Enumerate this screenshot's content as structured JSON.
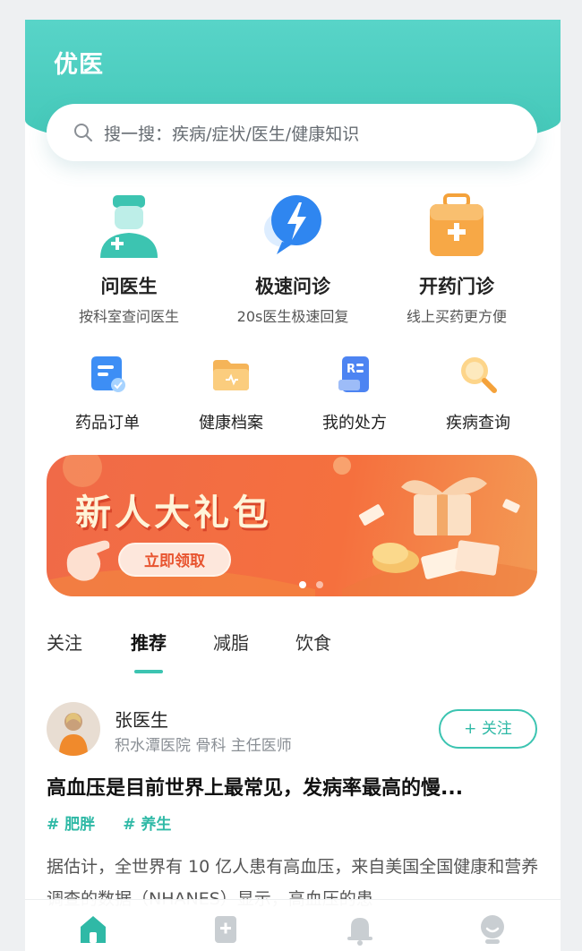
{
  "header": {
    "title": "优医"
  },
  "search": {
    "placeholder": "搜一搜：疾病/症状/医生/健康知识"
  },
  "services": [
    {
      "title": "问医生",
      "subtitle": "按科室查问医生",
      "icon": "doctor-icon"
    },
    {
      "title": "极速问诊",
      "subtitle": "20s医生极速回复",
      "icon": "lightning-chat-icon"
    },
    {
      "title": "开药门诊",
      "subtitle": "线上买药更方便",
      "icon": "medical-kit-icon"
    }
  ],
  "tools": [
    {
      "label": "药品订单",
      "icon": "order-icon"
    },
    {
      "label": "健康档案",
      "icon": "folder-icon"
    },
    {
      "label": "我的处方",
      "icon": "prescription-icon"
    },
    {
      "label": "疾病查询",
      "icon": "magnifier-icon"
    }
  ],
  "banner": {
    "title": "新人大礼包",
    "button": "立即领取",
    "slide_count": 2,
    "active_slide": 1,
    "colors": {
      "main": "#f06a48",
      "button_text": "#e8542f"
    }
  },
  "feed_tabs": [
    {
      "label": "关注",
      "active": false
    },
    {
      "label": "推荐",
      "active": true
    },
    {
      "label": "减脂",
      "active": false
    },
    {
      "label": "饮食",
      "active": false
    }
  ],
  "post": {
    "doctor_name": "张医生",
    "doctor_info": "积水潭医院 骨科 主任医师",
    "follow_label": "+ 关注",
    "title": "高血压是目前世界上最常见，发病率最高的慢...",
    "tags": [
      "# 肥胖",
      "# 养生"
    ],
    "body": "据估计，全世界有 10 亿人患有高血压，来自美国全国健康和营养调查的数据（NHANES）显示，高血压的患"
  },
  "bottom_nav": [
    {
      "name": "home",
      "icon": "home-icon",
      "active": true
    },
    {
      "name": "article",
      "icon": "article-icon",
      "active": false
    },
    {
      "name": "notification",
      "icon": "bell-icon",
      "active": false
    },
    {
      "name": "profile",
      "icon": "user-icon",
      "active": false
    }
  ],
  "colors": {
    "accent": "#3cc4b1",
    "header": "#4ecdc0"
  }
}
